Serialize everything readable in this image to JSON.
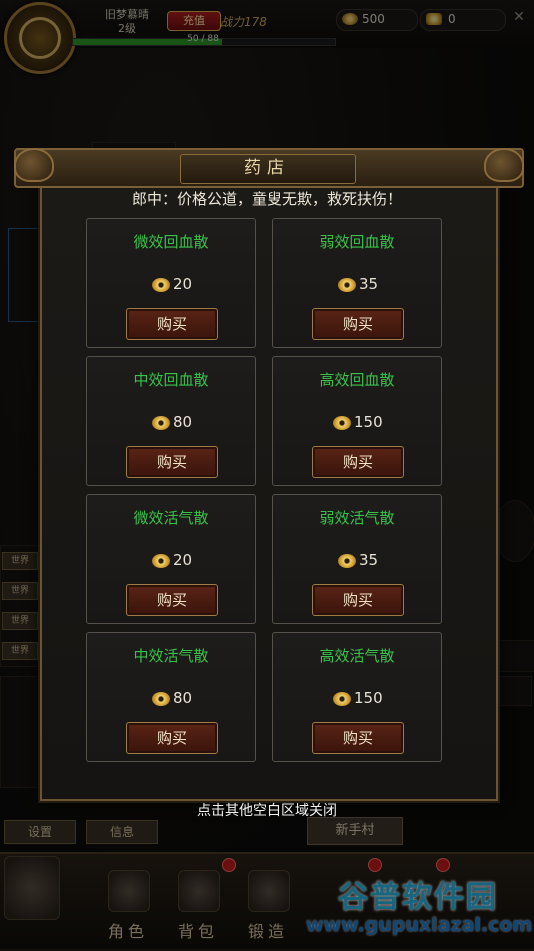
{
  "top_bar": {
    "player_name": "旧梦慕晴",
    "player_level": "2级",
    "recharge_label": "充值",
    "power_text": "战力178",
    "gold_amount": "500",
    "gem_amount": "0",
    "exp_text": "50 / 88",
    "exp_progress": 0.568
  },
  "chat": {
    "world_tag": "世界"
  },
  "background_buttons": {
    "settings_label": "设置",
    "info_label": "信息",
    "village_label": "新手村"
  },
  "bottom_nav": {
    "items": [
      {
        "label": "角色"
      },
      {
        "label": "背包"
      },
      {
        "label": "锻造"
      }
    ]
  },
  "shop": {
    "title": "药店",
    "subtitle": "郎中：价格公道，童叟无欺，救死扶伤！",
    "buy_label": "购买",
    "items": [
      {
        "name": "微效回血散",
        "price": "20"
      },
      {
        "name": "弱效回血散",
        "price": "35"
      },
      {
        "name": "中效回血散",
        "price": "80"
      },
      {
        "name": "高效回血散",
        "price": "150"
      },
      {
        "name": "微效活气散",
        "price": "20"
      },
      {
        "name": "弱效活气散",
        "price": "35"
      },
      {
        "name": "中效活气散",
        "price": "80"
      },
      {
        "name": "高效活气散",
        "price": "150"
      }
    ],
    "close_hint": "点击其他空白区域关闭"
  },
  "watermark": {
    "title": "谷普软件园",
    "url": "www.gupuxlazal.com"
  },
  "colors": {
    "item_name": "#38c24a",
    "panel_border": "#6b5433",
    "buy_button": "#5a2416",
    "exp_bar": "#2e9a2a"
  }
}
